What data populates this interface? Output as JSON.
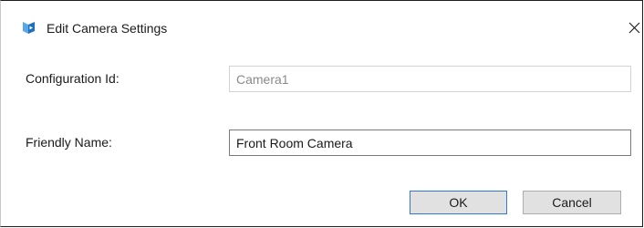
{
  "window": {
    "title": "Edit Camera Settings",
    "app_icon": "app-logo-icon",
    "close_icon": "close-icon"
  },
  "form": {
    "configuration_id": {
      "label": "Configuration Id:",
      "value": "Camera1",
      "disabled": true
    },
    "friendly_name": {
      "label": "Friendly Name:",
      "value": "Front Room Camera"
    }
  },
  "buttons": {
    "ok_label": "OK",
    "cancel_label": "Cancel"
  },
  "colors": {
    "accent": "#2d7bd5",
    "button_face": "#e1e1e1",
    "disabled_text": "#8a8a8a"
  }
}
